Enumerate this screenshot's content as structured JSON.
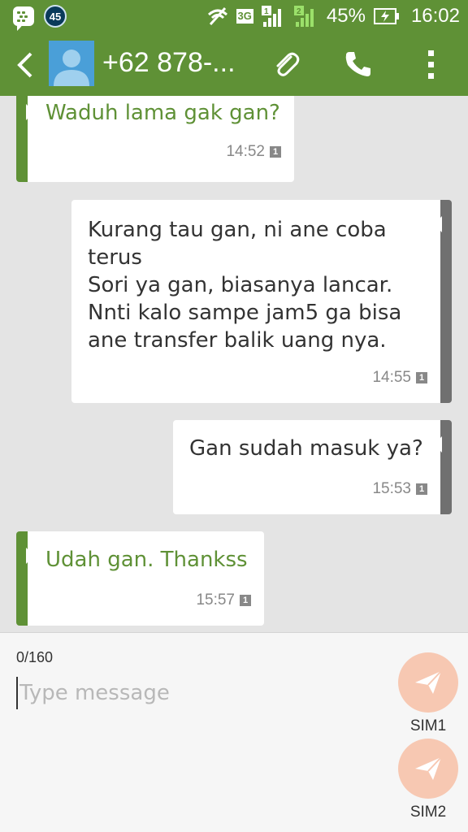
{
  "status_bar": {
    "notification_count": "45",
    "network_type": "3G",
    "sim1_label": "1",
    "sim2_label": "2",
    "battery_percent": "45%",
    "time": "16:02"
  },
  "header": {
    "contact_name": "+62 878-...",
    "icons": [
      "back-icon",
      "contact-avatar",
      "attach-icon",
      "phone-icon",
      "overflow-menu-icon"
    ]
  },
  "messages": [
    {
      "direction": "incoming",
      "lines": [
        "Waduh lama gak gan?"
      ],
      "time": "14:52",
      "sim": "1"
    },
    {
      "direction": "outgoing",
      "lines": [
        "Kurang tau gan, ni ane coba",
        "terus",
        "Sori ya gan, biasanya lancar.",
        "Nnti kalo sampe jam5 ga bisa",
        "ane transfer balik uang nya."
      ],
      "time": "14:55",
      "sim": "1"
    },
    {
      "direction": "outgoing",
      "lines": [
        "Gan sudah masuk ya?"
      ],
      "time": "15:53",
      "sim": "1"
    },
    {
      "direction": "incoming",
      "lines": [
        "Udah gan. Thankss"
      ],
      "time": "15:57",
      "sim": "1"
    }
  ],
  "compose": {
    "char_count": "0/160",
    "placeholder": "Type message",
    "value": "",
    "send_sim1_label": "SIM1",
    "send_sim2_label": "SIM2"
  },
  "colors": {
    "brand_green": "#5f9136",
    "outgoing_accent": "#707070",
    "send_button": "#f7c8b2",
    "background": "#e4e4e4"
  }
}
